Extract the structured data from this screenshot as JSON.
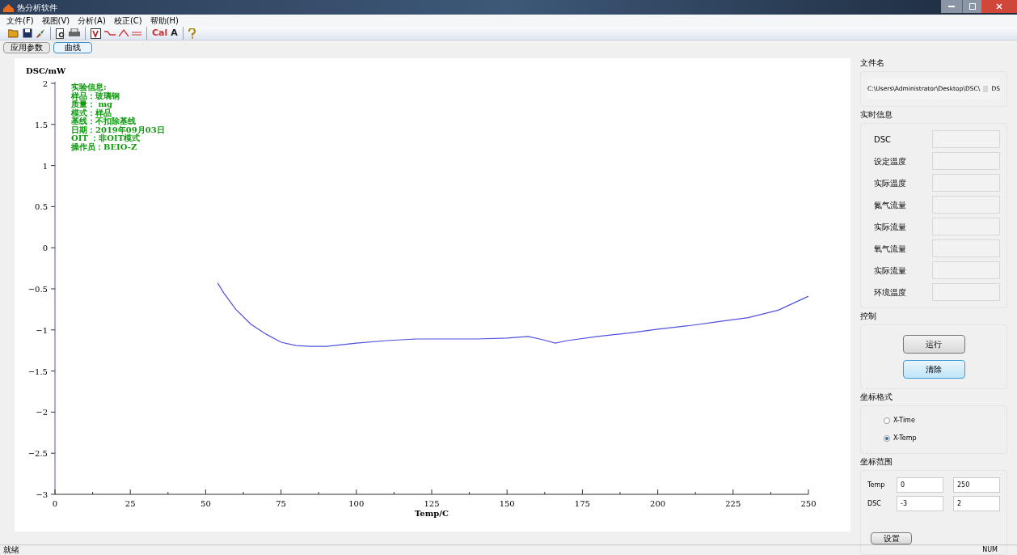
{
  "window": {
    "title": "热分析软件"
  },
  "menu": [
    "文件(F)",
    "视图(V)",
    "分析(A)",
    "校正(C)",
    "帮助(H)"
  ],
  "toolbar": [
    {
      "kind": "open"
    },
    {
      "kind": "save"
    },
    {
      "kind": "brush"
    },
    {
      "kind": "sep"
    },
    {
      "kind": "preview"
    },
    {
      "kind": "print"
    },
    {
      "kind": "sep"
    },
    {
      "kind": "filter"
    },
    {
      "kind": "step"
    },
    {
      "kind": "peak"
    },
    {
      "kind": "base"
    },
    {
      "kind": "sep"
    },
    {
      "kind": "text",
      "label": "Cal",
      "color": "#d03030"
    },
    {
      "kind": "text",
      "label": "A",
      "color": "#202020"
    },
    {
      "kind": "sep"
    },
    {
      "kind": "help"
    }
  ],
  "tabs": [
    {
      "label": "应用参数",
      "selected": false
    },
    {
      "label": "曲线",
      "selected": true
    }
  ],
  "plot": {
    "info": [
      "实验信息:",
      "样品：玻璃钢",
      "质量： mg",
      "模式：样品",
      "基线：不扣除基线",
      "日期：2019年09月03日",
      "OIT ：非OIT模式",
      "操作员：BEIO-Z"
    ],
    "chart_data": {
      "type": "line",
      "xlabel": "Temp/C",
      "ylabel": "DSC/mW",
      "xlim": [
        0,
        250
      ],
      "ylim": [
        -3,
        2
      ],
      "xticks": [
        0,
        25,
        50,
        75,
        100,
        125,
        150,
        175,
        200,
        225,
        250
      ],
      "yticks": [
        2,
        1.5,
        1,
        0.5,
        0,
        -0.5,
        -1,
        -1.5,
        -2,
        -2.5,
        -3
      ],
      "x": [
        54,
        56,
        60,
        65,
        70,
        75,
        80,
        85,
        90,
        95,
        100,
        110,
        120,
        130,
        140,
        150,
        157,
        162,
        166,
        170,
        180,
        190,
        200,
        210,
        220,
        230,
        240,
        250
      ],
      "series": [
        {
          "color": "#5050e0",
          "values": [
            -0.43,
            -0.55,
            -0.75,
            -0.93,
            -1.05,
            -1.15,
            -1.19,
            -1.2,
            -1.2,
            -1.18,
            -1.16,
            -1.13,
            -1.11,
            -1.11,
            -1.11,
            -1.1,
            -1.08,
            -1.12,
            -1.16,
            -1.13,
            -1.08,
            -1.04,
            -0.99,
            -0.95,
            -0.9,
            -0.85,
            -0.76,
            -0.59
          ]
        }
      ]
    }
  },
  "file": {
    "heading": "文件名",
    "path_start": "C:\\Users\\Administrator\\Desktop\\DSC\\",
    "path_end": "DS"
  },
  "realtime": {
    "heading": "实时信息",
    "fields": [
      "DSC",
      "设定温度",
      "实际温度",
      "氮气流量",
      "实际流量",
      "氧气流量",
      "实际流量",
      "环境温度"
    ]
  },
  "control": {
    "heading": "控制",
    "buttons": [
      {
        "label": "运行",
        "selected": false
      },
      {
        "label": "清除",
        "selected": true
      }
    ]
  },
  "axis_format": {
    "heading": "坐标格式",
    "options": [
      {
        "label": "X-Time",
        "selected": false
      },
      {
        "label": "X-Temp",
        "selected": true
      }
    ]
  },
  "axis_range": {
    "heading": "坐标范围",
    "rows": [
      {
        "label": "Temp",
        "min": "0",
        "max": "250"
      },
      {
        "label": "DSC",
        "min": "-3",
        "max": "2"
      }
    ],
    "button": "设置"
  },
  "status_bar": {
    "message": "就绪",
    "indicator": "NUM"
  }
}
